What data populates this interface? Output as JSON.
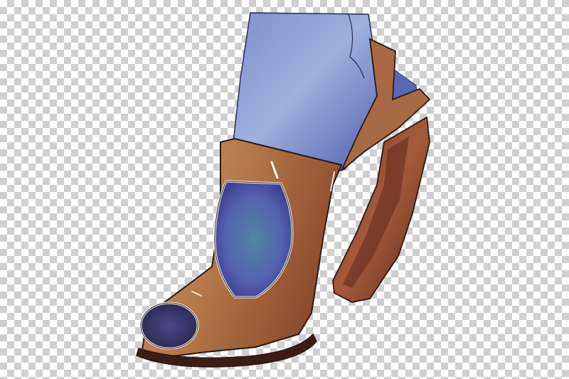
{
  "image": {
    "subject": "watercolor-high-heel-shoe-illustration",
    "background": "transparency-checkerboard",
    "colors": {
      "checker_dark": "#cfcfcf",
      "checker_light": "#ffffff",
      "denim_light": "#8aa0d4",
      "denim_mid": "#5667b4",
      "denim_dark": "#3a3f8e",
      "leather_light": "#c9955e",
      "leather_mid": "#a7653c",
      "leather_dark": "#6b3524",
      "outline": "#2a1a14",
      "toe": "#3a3466"
    }
  }
}
